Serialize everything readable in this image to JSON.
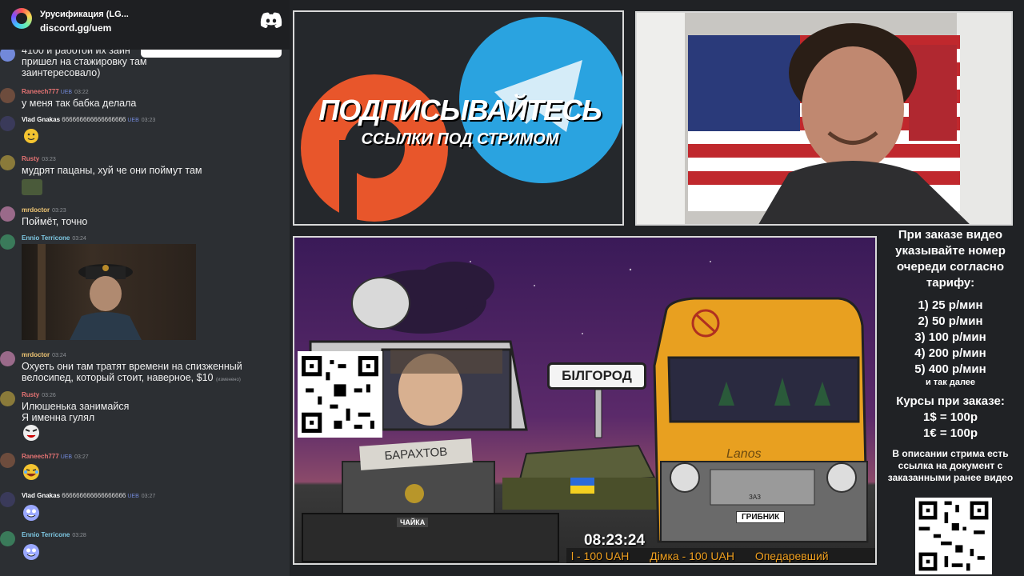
{
  "discord": {
    "title": "Урусификация (LG...",
    "invite": "discord.gg/uem"
  },
  "chat": {
    "messages": [
      {
        "name": "",
        "badges": "",
        "time": "",
        "text": "4100 и работой их заин\nпришел на стажировку там\nзаинтересовало)"
      },
      {
        "name": "Raneech777",
        "badges": "UEB",
        "time": "03:22",
        "name_color": "#e57373",
        "text": "у меня так бабка делала"
      },
      {
        "name": "Vlad Gnakas",
        "badges": "UEB",
        "time": "03:23",
        "name_color": "#ffffff",
        "name_suffix": "666666666666666666",
        "text": ""
      },
      {
        "name": "Rusty",
        "badges": "",
        "time": "03:23",
        "name_color": "#e57373",
        "text": "мудрят пацаны, хуй че они поймут там"
      },
      {
        "name": "mrdoctor",
        "badges": "",
        "time": "03:23",
        "name_color": "#f0c674",
        "text": "Поймёт, точно"
      },
      {
        "name": "Ennio Terricone",
        "badges": "",
        "time": "03:24",
        "name_color": "#7ec8e3",
        "text": ""
      },
      {
        "name": "mrdoctor",
        "badges": "",
        "time": "03:24",
        "name_color": "#f0c674",
        "text": "Охуеть они там тратят времени на спизженный\nвелосипед, который стоит, наверное, $10",
        "edited": "(изменено)"
      },
      {
        "name": "Rusty",
        "badges": "",
        "time": "03:26",
        "name_color": "#e57373",
        "text": "Илюшенька занимайся\nЯ именна гулял"
      },
      {
        "name": "Raneech777",
        "badges": "UEB",
        "time": "03:27",
        "name_color": "#e57373",
        "text": ""
      },
      {
        "name": "Vlad Gnakas",
        "badges": "UEB",
        "time": "03:27",
        "name_color": "#ffffff",
        "name_suffix": "666666666666666666",
        "text": ""
      },
      {
        "name": "Ennio Terricone",
        "badges": "",
        "time": "03:28",
        "name_color": "#7ec8e3",
        "text": ""
      }
    ]
  },
  "promo": {
    "line1": "ПОДПИСЫВАЙТЕСЬ",
    "line2": "ССЫЛКИ ПОД СТРИМОМ"
  },
  "scene": {
    "sign": "БІЛГОРОД",
    "truck_label": "БАРАХТОВ",
    "engine_label": "ЧАЙКА",
    "van_brand": "Lanos",
    "van_plate": "ГРИБНИК",
    "van_maker": "ЗАЗ",
    "clock": "08:23:24",
    "ticker": [
      "l - 100 UAH",
      "Дімка - 100 UAH",
      "Опедаревший"
    ]
  },
  "info": {
    "intro": "При заказе видео указывайте номер очереди согласно тарифу:",
    "tariffs": [
      "1) 25 р/мин",
      "2) 50 р/мин",
      "3) 100 р/мин",
      "4) 200 р/мин",
      "5) 400 р/мин"
    ],
    "etc": "и так далее",
    "rates_title": "Курсы при заказе:",
    "rates": [
      "1$ = 100р",
      "1€ = 100р"
    ],
    "outro": "В описании стрима есть ссылка на документ с заказанными ранее видео"
  },
  "colors": {
    "chat_bg": "#2c2f33",
    "page_bg": "#202225",
    "telegram_blue": "#2aa3e0",
    "patreon_orange": "#e8562b",
    "ticker": "#f0a020",
    "van_orange": "#e8a020"
  }
}
